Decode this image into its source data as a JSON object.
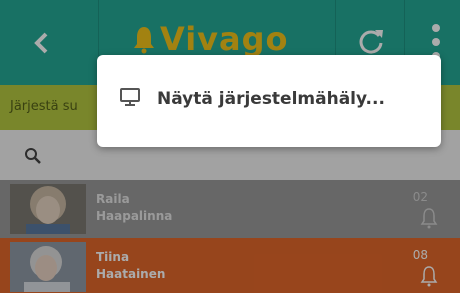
{
  "header": {
    "back_icon": "chevron-left-icon",
    "logo_text": "Vivago",
    "logo_icon": "bell-icon",
    "refresh_icon": "refresh-icon",
    "more_icon": "more-vertical-icon"
  },
  "sortbar": {
    "label": "Järjestä su"
  },
  "search": {
    "icon": "search-icon"
  },
  "residents": [
    {
      "first_name": "Raila",
      "last_name": "Haapalinna",
      "number": "02",
      "icon": "bell-icon",
      "color": "#9a9a9a"
    },
    {
      "first_name": "Tiina",
      "last_name": "Haatainen",
      "number": "08",
      "icon": "bell-icon",
      "color": "#e2672a"
    }
  ],
  "popup": {
    "item_label": "Näytä järjestelmähäly...",
    "item_icon": "monitor-icon"
  },
  "colors": {
    "header": "#24a996",
    "sortbar": "#b5c840",
    "accent": "#e2672a",
    "logo": "#f2c21a"
  }
}
